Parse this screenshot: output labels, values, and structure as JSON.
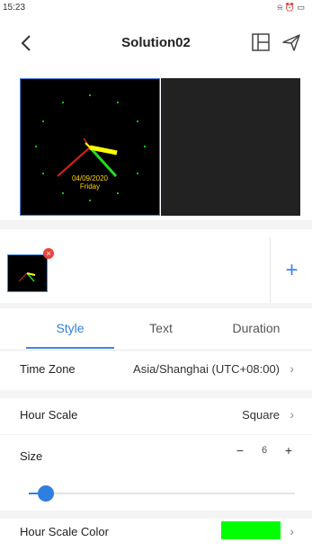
{
  "status_bar": {
    "time": "15:23",
    "right_icons": "⍾ ⏰ ▭"
  },
  "header": {
    "title": "Solution02"
  },
  "clock": {
    "date": "04/09/2020",
    "day": "Friday"
  },
  "thumbnail": {
    "delete_symbol": "×"
  },
  "add_button": {
    "symbol": "+"
  },
  "tabs": [
    {
      "label": "Style",
      "active": true
    },
    {
      "label": "Text",
      "active": false
    },
    {
      "label": "Duration",
      "active": false
    }
  ],
  "settings": {
    "time_zone": {
      "label": "Time Zone",
      "value": "Asia/Shanghai (UTC+08:00)"
    },
    "hour_scale": {
      "label": "Hour Scale",
      "value": "Square"
    },
    "size": {
      "label": "Size",
      "value": "6",
      "minus": "−",
      "plus": "+",
      "slider_fraction": 0.05
    },
    "hour_scale_color": {
      "label": "Hour Scale Color",
      "color": "#00ff00"
    }
  },
  "chevron": "›",
  "colors": {
    "accent": "#2f7fe0",
    "hour_scale_color": "#00ff00",
    "delete": "#e8463f"
  }
}
